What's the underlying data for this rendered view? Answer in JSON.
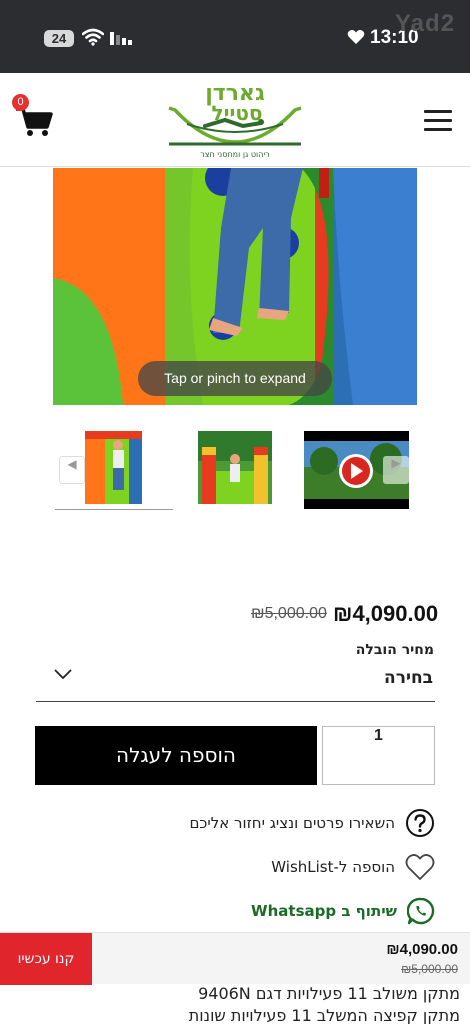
{
  "status_bar": {
    "battery": "24",
    "time": "13:10",
    "watermark": "Yad2"
  },
  "header": {
    "cart_count": "0",
    "logo_text": "גארדן סטייל",
    "logo_subtitle": "ריהוט גן ומחסני חצר"
  },
  "gallery": {
    "expand_hint": "Tap or pinch to expand"
  },
  "price": {
    "current": "₪4,090.00",
    "original": "₪5,000.00"
  },
  "delivery": {
    "label": "מחיר הובלה",
    "selected": "בחירה"
  },
  "cart": {
    "add_label": "הוספה לעגלה",
    "quantity": "1"
  },
  "actions": {
    "inquiry": "השאירו פרטים ונציג יחזור אליכם",
    "wishlist": "הוספה ל-WishList",
    "whatsapp": "שיתוף ב Whatsapp"
  },
  "sticky_bar": {
    "buy_now": "קנו עכשיו",
    "price": "₪4,090.00",
    "original": "₪5,000.00"
  },
  "description": {
    "line1": "מתקן משולב 11 פעילויות דגם 9406N",
    "line2": "מתקן קפיצה המשלב 11 פעילויות שונות"
  },
  "colors": {
    "accent_red": "#e0262c",
    "whatsapp_green": "#1b6b26",
    "button_black": "#000000"
  }
}
